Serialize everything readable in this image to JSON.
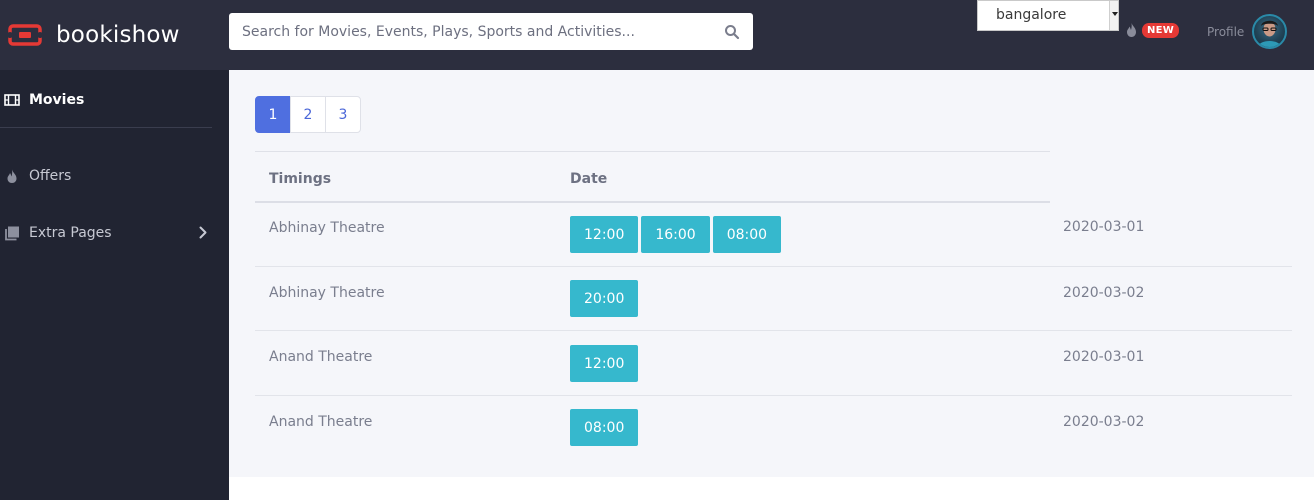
{
  "brand": {
    "name": "bookishow",
    "logo_color": "#e53935"
  },
  "search": {
    "placeholder": "Search for Movies, Events, Plays, Sports and Activities..."
  },
  "city": {
    "selected": "bangalore"
  },
  "badge": {
    "new_label": "NEW"
  },
  "profile": {
    "label": "Profile"
  },
  "sidebar": {
    "items": [
      {
        "label": "Movies",
        "icon": "film-icon",
        "active": true
      },
      {
        "label": "Offers",
        "icon": "fire-icon",
        "active": false
      },
      {
        "label": "Extra Pages",
        "icon": "pages-icon",
        "active": false
      }
    ]
  },
  "pagination": {
    "pages": [
      "1",
      "2",
      "3"
    ],
    "current": "1"
  },
  "table": {
    "headers": {
      "timings": "Timings",
      "date": "Date"
    },
    "rows": [
      {
        "theatre": "Abhinay Theatre",
        "times": [
          "12:00",
          "16:00",
          "08:00"
        ],
        "date": "2020-03-01"
      },
      {
        "theatre": "Abhinay Theatre",
        "times": [
          "20:00"
        ],
        "date": "2020-03-02"
      },
      {
        "theatre": "Anand Theatre",
        "times": [
          "12:00"
        ],
        "date": "2020-03-01"
      },
      {
        "theatre": "Anand Theatre",
        "times": [
          "08:00"
        ],
        "date": "2020-03-02"
      }
    ]
  },
  "colors": {
    "topbar": "#2c2e3e",
    "sidebar": "#212432",
    "accent": "#4f6fe0",
    "time_button": "#36b8cd",
    "new_badge": "#e53935"
  }
}
